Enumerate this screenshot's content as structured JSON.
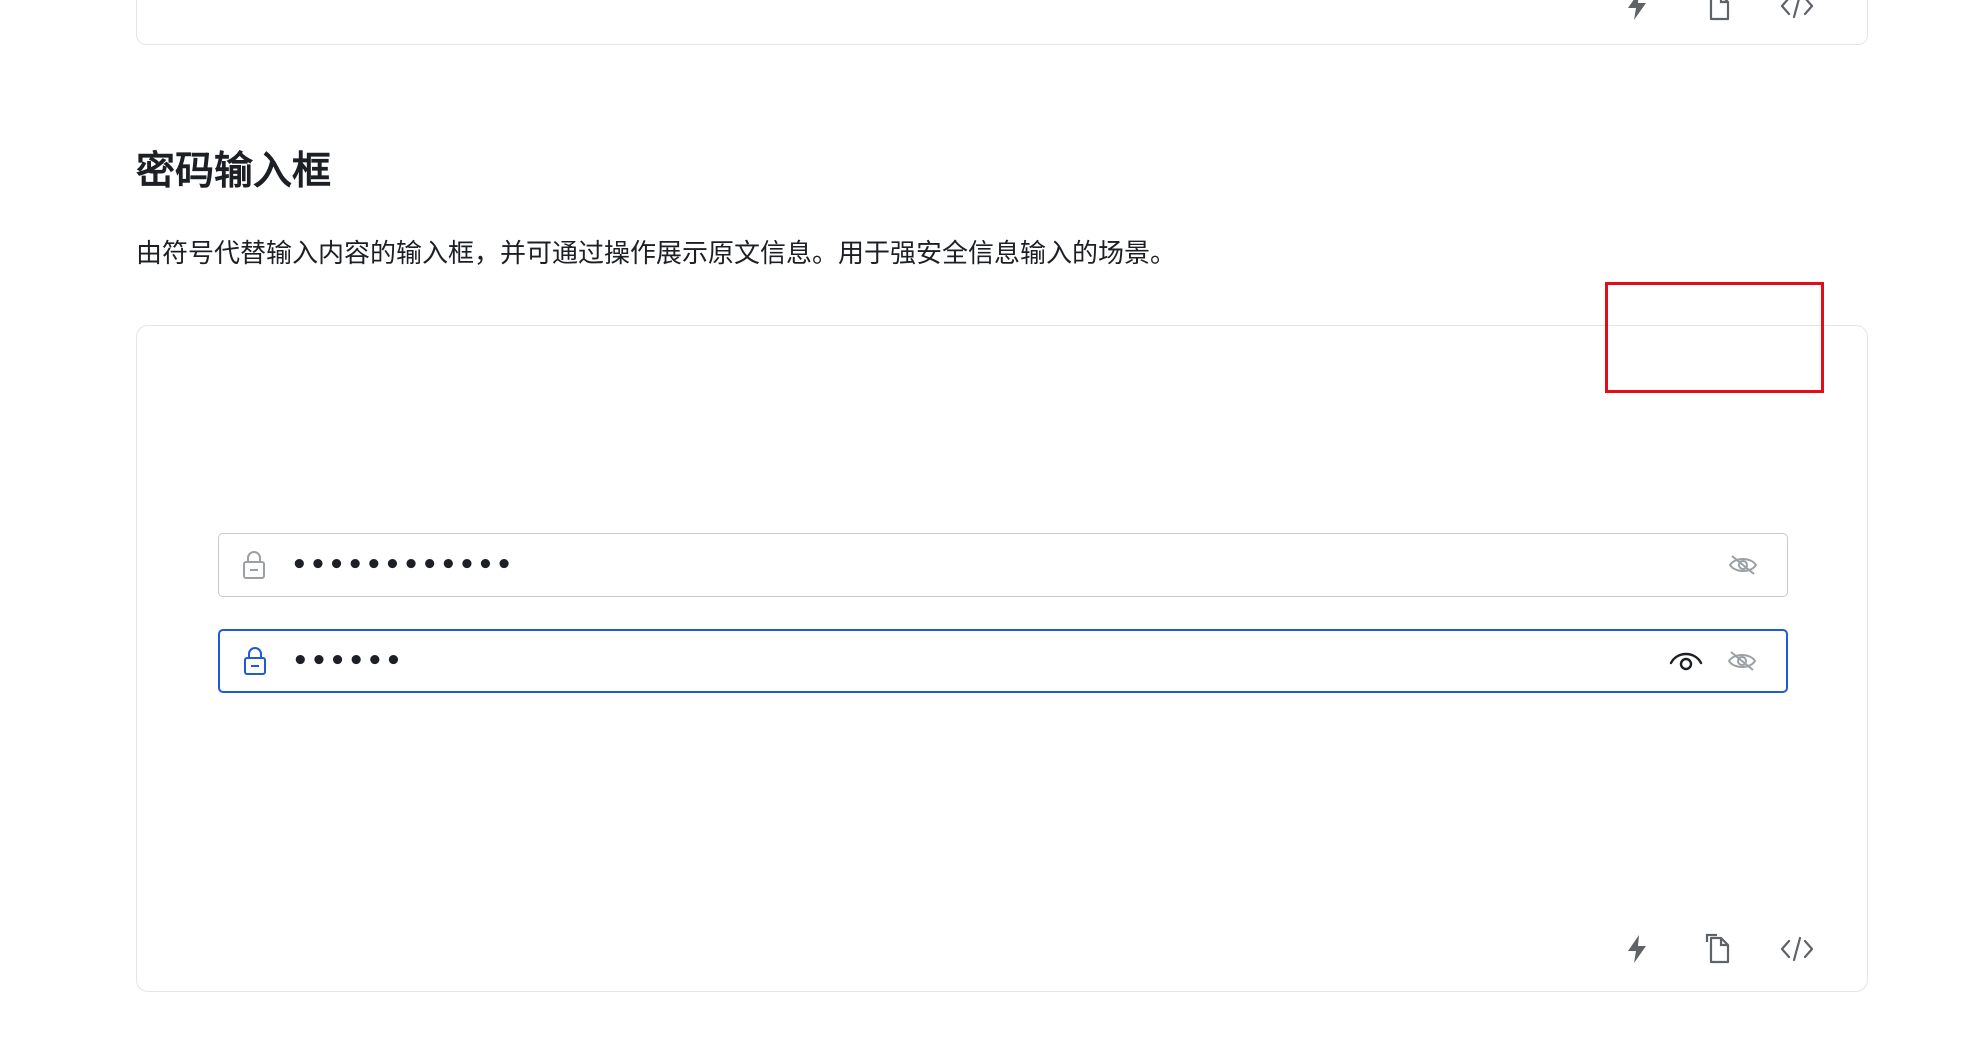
{
  "top_card": {
    "toolbar": [
      {
        "name": "run-icon"
      },
      {
        "name": "copy-icon"
      },
      {
        "name": "code-icon"
      }
    ]
  },
  "section": {
    "title": "密码输入框",
    "description": "由符号代替输入内容的输入框，并可通过操作展示原文信息。用于强安全信息输入的场景。"
  },
  "demo": {
    "inputs": [
      {
        "state": "default",
        "prefix_icon": "lock-icon",
        "masked_value": "••••••••••••",
        "suffix_icons": [
          "eye-off-icon"
        ]
      },
      {
        "state": "focused",
        "prefix_icon": "lock-icon",
        "masked_value": "••••••",
        "suffix_icons": [
          "eye-icon",
          "eye-off-icon"
        ]
      }
    ],
    "toolbar": [
      {
        "name": "run-icon"
      },
      {
        "name": "copy-icon"
      },
      {
        "name": "code-icon"
      }
    ]
  },
  "colors": {
    "text": "#1c1f23",
    "border": "#e3e5e8",
    "input_border": "#c6cacd",
    "focus_border": "#1f5ad8",
    "icon_muted": "#9aa0a6",
    "highlight": "#e60b17"
  }
}
